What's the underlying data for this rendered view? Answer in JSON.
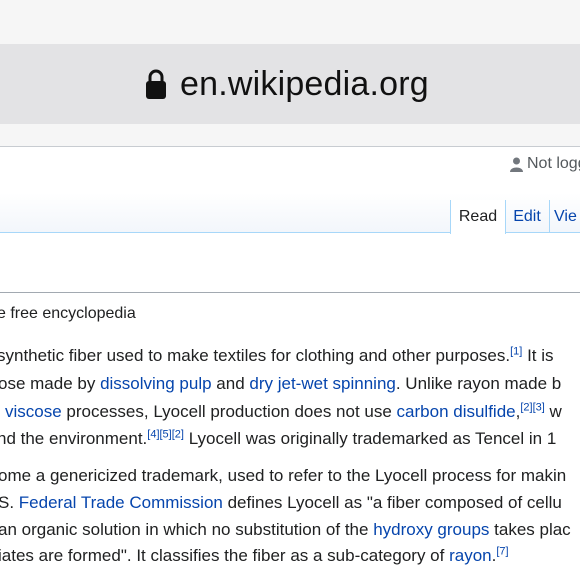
{
  "browser": {
    "url": "en.wikipedia.org"
  },
  "header": {
    "user_status": "Not logg"
  },
  "tabs": [
    {
      "label": "Read"
    },
    {
      "label": "Edit"
    },
    {
      "label": "Vie"
    }
  ],
  "tagline": "e free encyclopedia",
  "article": {
    "l1": {
      "t1": "synthetic fiber used to make textiles for clothing and other purposes.",
      "ref1": "[1]",
      "t2": " It is"
    },
    "l2": {
      "t1": "ose made by ",
      "link1": "dissolving pulp",
      "t2": " and ",
      "link2": "dry jet-wet spinning",
      "t3": ". Unlike rayon made b"
    },
    "l3": {
      "link1": "viscose",
      "t1": " processes, Lyocell production does not use ",
      "link2": "carbon disulfide",
      "t2": ",",
      "ref1": "[2]",
      "ref2": "[3]",
      "t3": " w"
    },
    "l4": {
      "t1": "nd the environment.",
      "ref1": "[4]",
      "ref2": "[5]",
      "ref3": "[2]",
      "t2": " Lyocell was originally trademarked as Tencel in 1"
    },
    "l5": {
      "t1": "ome a genericized trademark, used to refer to the Lyocell process for makin"
    },
    "l6": {
      "t1": "S. ",
      "link1": "Federal Trade Commission",
      "t2": " defines Lyocell as \"a fiber composed of cellu"
    },
    "l7": {
      "t1": "an organic solution in which no substitution of the ",
      "link1": "hydroxy groups",
      "t2": " takes plac"
    },
    "l8": {
      "t1": "iates are formed\". It classifies the fiber as a sub-category of ",
      "link1": "rayon",
      "t2": ".",
      "ref1": "[7]"
    }
  },
  "colors": {
    "link": "#0645ad",
    "text": "#202122",
    "url_bar": "#e3e3e5"
  }
}
